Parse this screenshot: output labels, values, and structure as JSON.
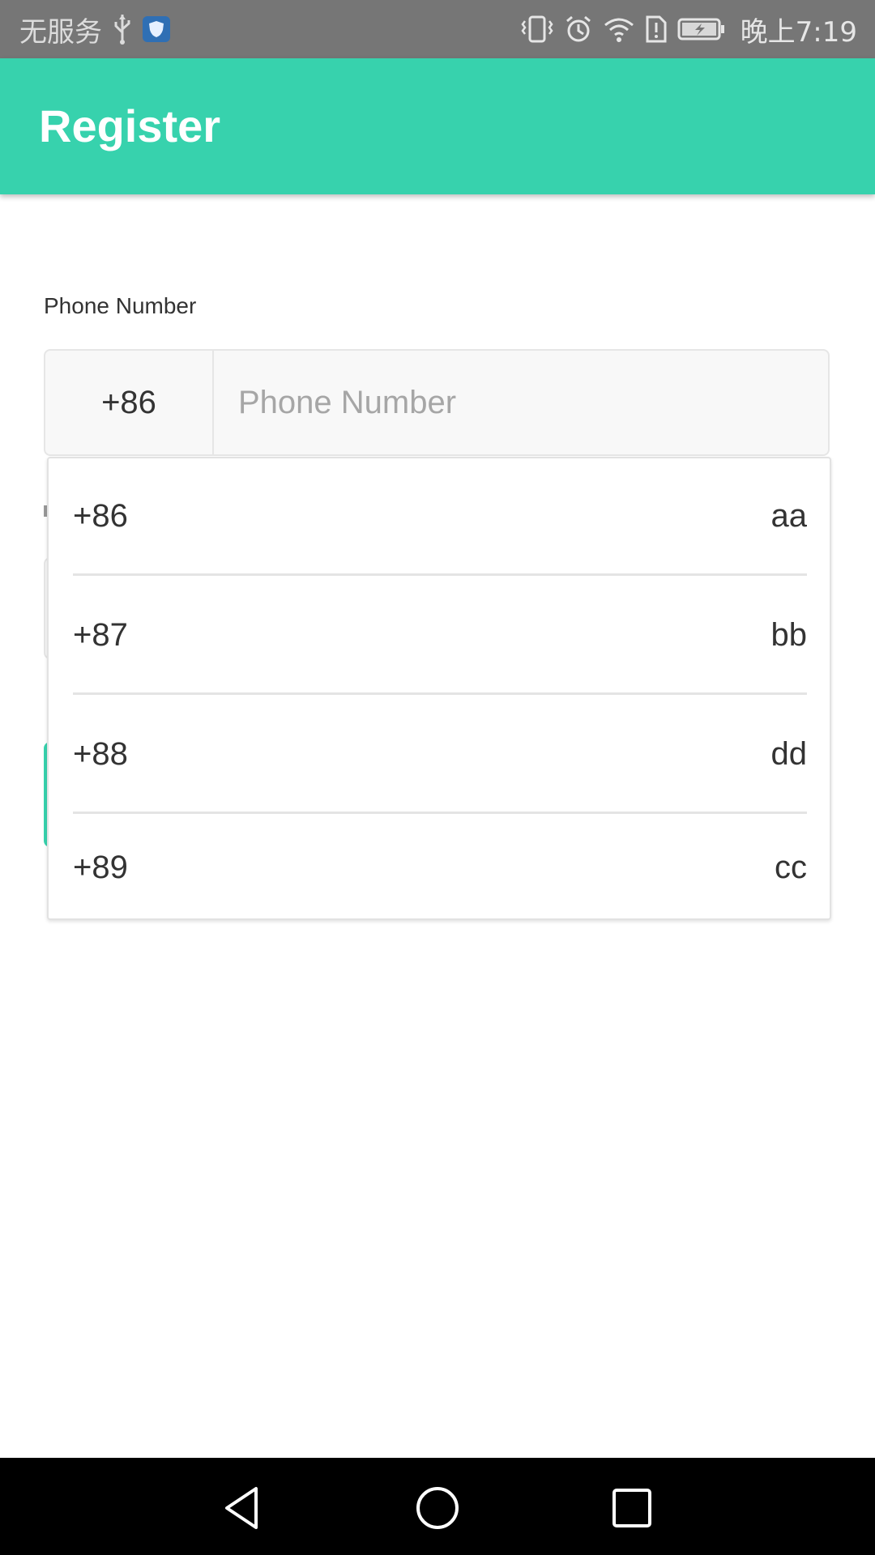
{
  "status_bar": {
    "carrier": "无服务",
    "time": "晚上7:19",
    "icons": [
      "usb-icon",
      "shield-icon",
      "vibrate-icon",
      "alarm-icon",
      "wifi-icon",
      "sim-alert-icon",
      "battery-charging-icon"
    ]
  },
  "app_bar": {
    "title": "Register",
    "color": "#37d2ad"
  },
  "form": {
    "phone_label": "Phone Number",
    "country_code": "+86",
    "phone_placeholder": "Phone Number",
    "phone_value": ""
  },
  "dropdown": {
    "options": [
      {
        "code": "+86",
        "name": "aa"
      },
      {
        "code": "+87",
        "name": "bb"
      },
      {
        "code": "+88",
        "name": "dd"
      },
      {
        "code": "+89",
        "name": "cc"
      }
    ]
  },
  "nav_bar": {
    "icons": [
      "back-icon",
      "home-icon",
      "recents-icon"
    ]
  }
}
